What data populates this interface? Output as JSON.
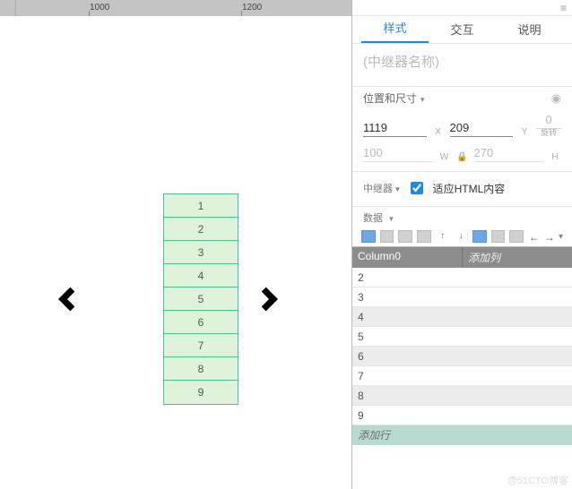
{
  "ruler": {
    "marks": [
      "1000",
      "1200"
    ]
  },
  "canvas": {
    "repeater_rows": [
      "1",
      "2",
      "3",
      "4",
      "5",
      "6",
      "7",
      "8",
      "9"
    ]
  },
  "inspector": {
    "tabs": {
      "style": "样式",
      "interact": "交互",
      "note": "说明"
    },
    "name_placeholder": "(中继器名称)",
    "pos_section": "位置和尺寸",
    "x_value": "1119",
    "x_label": "X",
    "y_value": "209",
    "y_label": "Y",
    "rot_value": "0",
    "rot_label": "旋转",
    "w_value": "100",
    "w_label": "W",
    "h_value": "270",
    "h_label": "H",
    "repeater_section": "中继器",
    "fit_html_label": "适应HTML内容",
    "data_section": "数据",
    "grid": {
      "col0": "Column0",
      "add_col": "添加列",
      "rows": [
        "2",
        "3",
        "4",
        "5",
        "6",
        "7",
        "8",
        "9"
      ],
      "add_row": "添加行"
    }
  },
  "watermark": "@51CTO博客"
}
